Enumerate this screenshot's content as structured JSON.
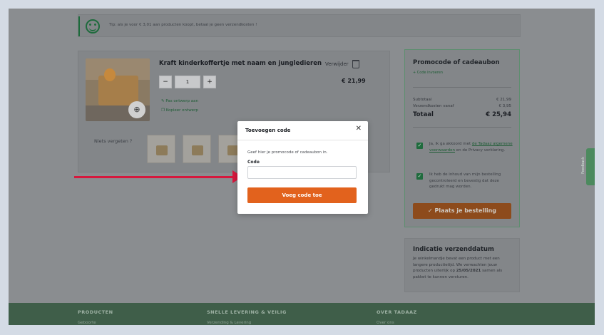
{
  "tip": {
    "text": "Tip: als je voor € 3,01 aan producten koopt, betaal je geen verzendkosten !"
  },
  "cart": {
    "product_title": "Kraft kinderkoffertje met naam en jungledieren",
    "remove_label": "Verwijder",
    "quantity": "1",
    "minus_label": "−",
    "plus_label": "+",
    "price": "€ 21,99",
    "link_edit": "Pas ontwerp aan",
    "link_copy": "Kopieer ontwerp",
    "see_also": "Niets vergeten ?"
  },
  "summary": {
    "promo_title": "Promocode of cadeaubon",
    "promo_link": "+ Code invoeren",
    "subtotal_label": "Subtotaal",
    "subtotal_value": "€ 21,99",
    "shipping_label": "Verzendkosten vanaf",
    "shipping_value": "€ 3,95",
    "total_label": "Totaal",
    "total_value": "€ 25,94",
    "terms_pre": "Ja, ik ga akkoord met ",
    "terms_link": "de Tadaaz algemene voorwaarden",
    "terms_post": " en de Privacy verklaring.",
    "check_text": "Ik heb de inhoud van mijn bestelling gecontroleerd en bevestig dat deze gedrukt mag worden.",
    "order_button": "✓  Plaats je bestelling"
  },
  "shipping": {
    "title": "Indicatie verzenddatum",
    "text_pre": "Je winkelmandje bevat een product met een langere productietijd. We verwachten jouw producten uiterlijk op ",
    "date": "25/05/2021",
    "text_post": " samen als pakket te kunnen versturen."
  },
  "footer": {
    "col1": "PRODUCTEN",
    "col2": "SNELLE LEVERING & VEILIG",
    "col3": "OVER TADAAZ",
    "col1_sub": "Geboorte",
    "col2_sub": "Verzending & Levering",
    "col3_sub": "Over ons"
  },
  "feedback": {
    "label": "Feedback"
  },
  "modal": {
    "title": "Toevoegen code",
    "close": "✕",
    "info": "Geef hier je promocode of cadeaubon in.",
    "label": "Code",
    "input_value": "",
    "button": "Voeg code toe"
  },
  "colors": {
    "brand_green": "#1f6b3d",
    "accent_orange": "#e2621d",
    "arrow_red": "#d6183d",
    "footer_green": "#3f5e49"
  },
  "icons": [
    "smiley-icon",
    "trash-icon",
    "zoom-icon",
    "pencil-icon",
    "copy-icon",
    "checkbox-icon",
    "check-icon",
    "close-icon"
  ]
}
